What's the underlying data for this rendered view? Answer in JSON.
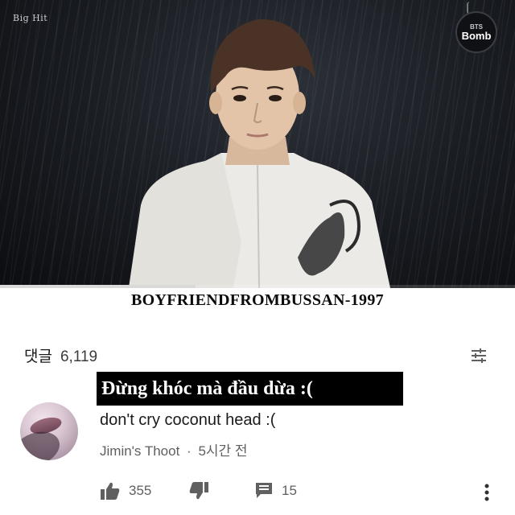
{
  "video": {
    "corner_logo": "Big Hit",
    "badge_top": "BTS",
    "badge_bottom": "Bomb",
    "progress_fraction": 0.38
  },
  "caption": "BOYFRIENDFROMBUSSAN-1997",
  "comments_section": {
    "label": "댓글",
    "count": "6,119",
    "sort_icon": "sort-icon"
  },
  "overlay_text": "Đừng khóc mà đầu dừa :(",
  "comment": {
    "text": "don't cry coconut head :(",
    "author": "Jimin's Thoot",
    "separator": "·",
    "time": "5시간 전",
    "likes": "355",
    "replies": "15"
  },
  "icons": {
    "like": "thumbs-up-icon",
    "dislike": "thumbs-down-icon",
    "reply": "reply-icon",
    "more": "more-vertical-icon"
  },
  "colors": {
    "video_bg": "#181b20",
    "text_primary": "#0f0f0f",
    "text_secondary": "#5f5f5f",
    "overlay_bg": "#000000"
  }
}
